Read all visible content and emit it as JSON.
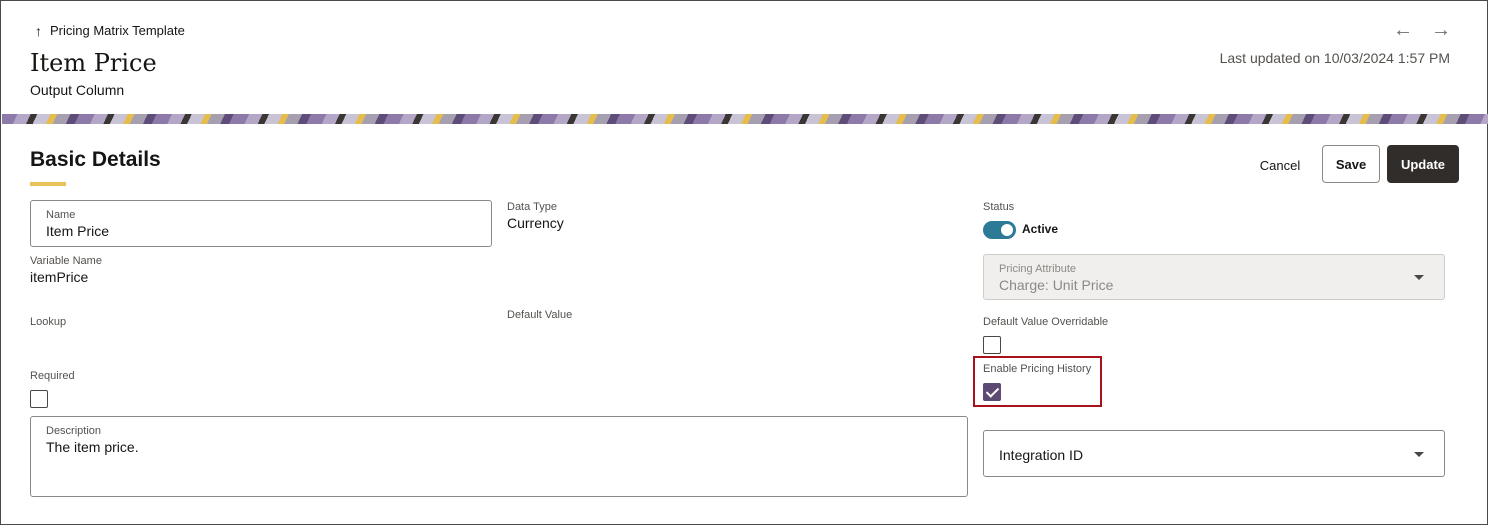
{
  "header": {
    "back_label": "Pricing Matrix Template",
    "title": "Item Price",
    "subtitle": "Output Column",
    "prev_arrow": "←",
    "next_arrow": "→",
    "last_updated": "Last updated on 10/03/2024 1:57 PM"
  },
  "section": {
    "title": "Basic Details",
    "accent_color": "#e8c15a"
  },
  "actions": {
    "cancel_label": "Cancel",
    "save_label": "Save",
    "update_label": "Update"
  },
  "form": {
    "name": {
      "label": "Name",
      "value": "Item Price"
    },
    "variable_name": {
      "label": "Variable Name",
      "value": "itemPrice"
    },
    "lookup": {
      "label": "Lookup"
    },
    "required": {
      "label": "Required",
      "checked": false
    },
    "description": {
      "label": "Description",
      "value": "The item price."
    },
    "data_type": {
      "label": "Data Type",
      "value": "Currency"
    },
    "default_value": {
      "label": "Default Value"
    },
    "status": {
      "label": "Status",
      "value": "Active",
      "on": true
    },
    "pricing_attribute": {
      "label": "Pricing Attribute",
      "value": "Charge: Unit Price",
      "disabled": true
    },
    "default_value_overridable": {
      "label": "Default Value Overridable",
      "checked": false
    },
    "enable_pricing_history": {
      "label": "Enable Pricing History",
      "checked": true
    },
    "integration_id": {
      "label": "Integration ID"
    }
  },
  "colors": {
    "primary_button": "#312d2a",
    "toggle_on": "#2c7a96",
    "checkbox_checked": "#5c4a72",
    "highlight_border": "#a8121a"
  },
  "icons": {
    "back": "arrow-up-icon",
    "prev": "arrow-left-icon",
    "next": "arrow-right-icon",
    "dropdown": "chevron-down-icon"
  }
}
